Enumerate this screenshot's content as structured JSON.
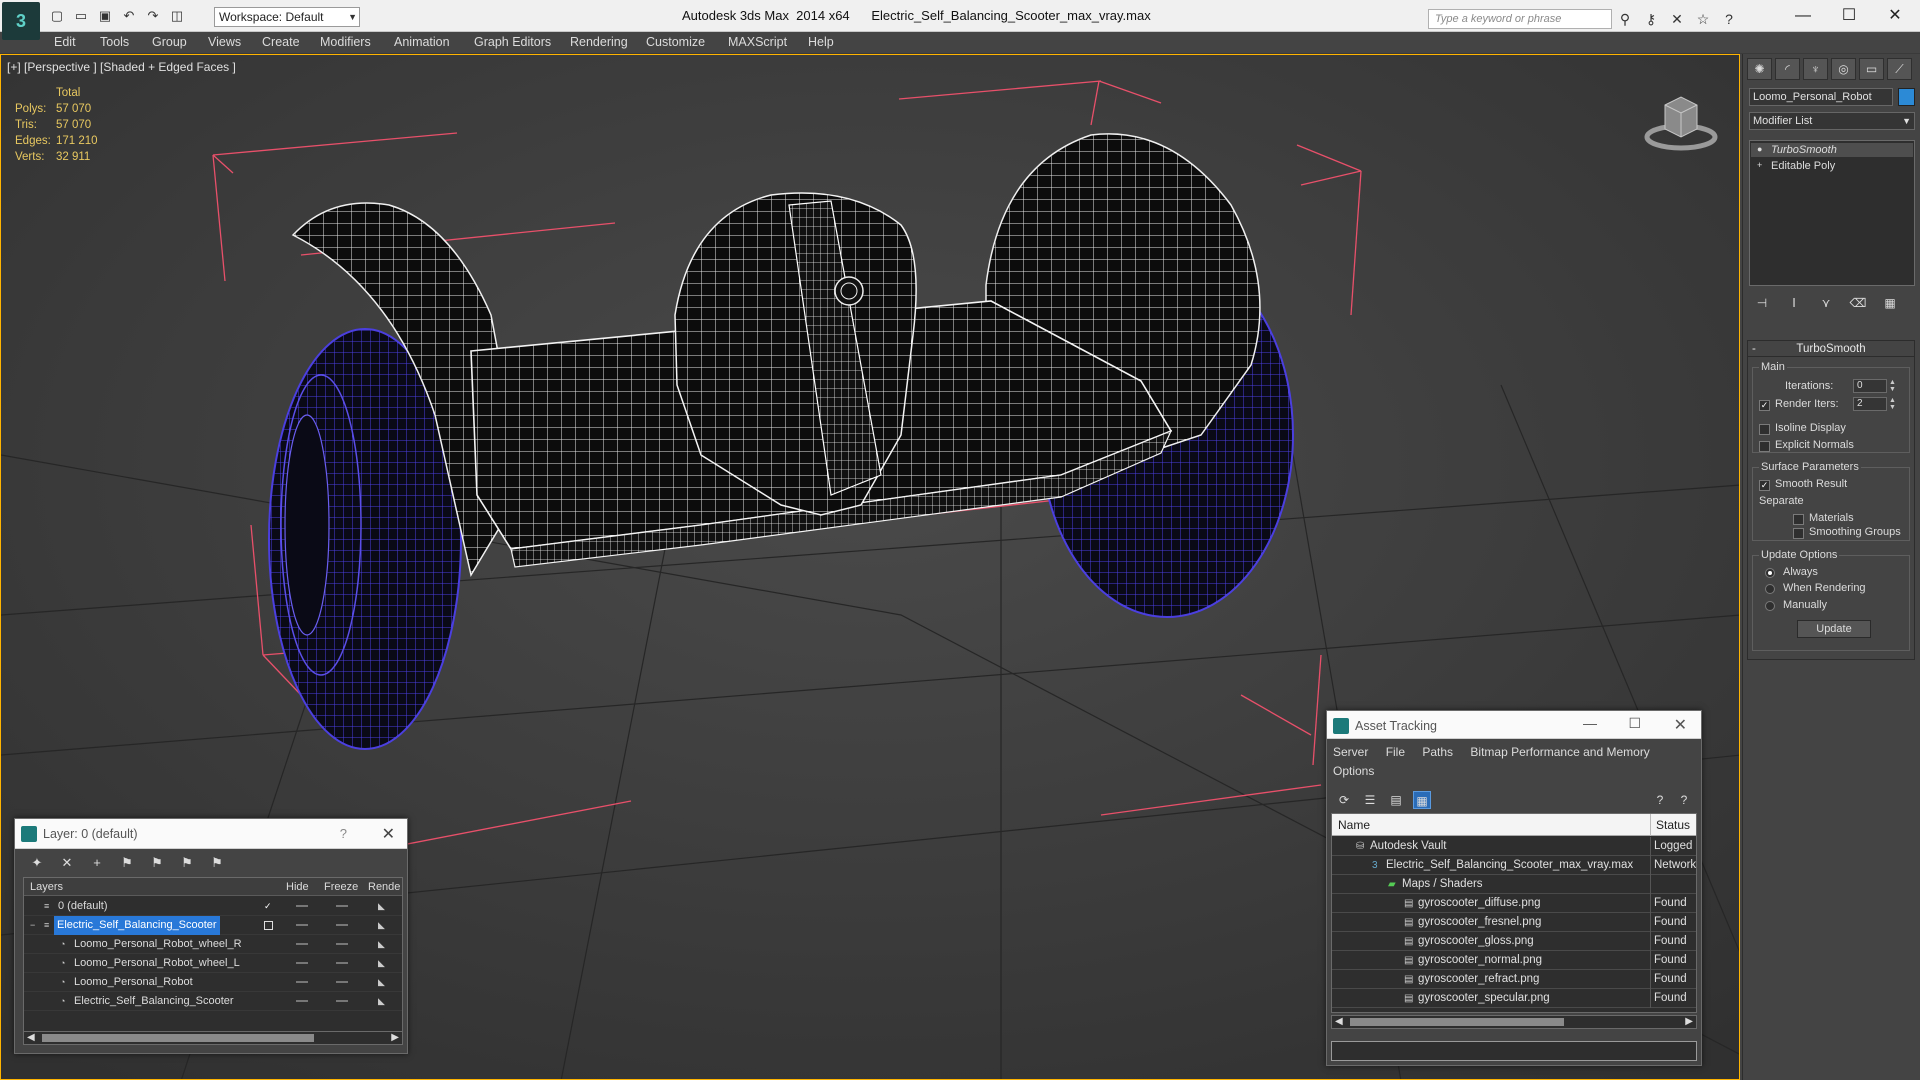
{
  "titlebar": {
    "title": "Autodesk 3ds Max  2014 x64      Electric_Self_Balancing_Scooter_max_vray.max",
    "workspace_label": "Workspace: Default",
    "search_placeholder": "Type a keyword or phrase",
    "minimize_label": "—",
    "maximize_label": "☐",
    "close_label": "✕"
  },
  "menu": [
    "Edit",
    "Tools",
    "Group",
    "Views",
    "Create",
    "Modifiers",
    "Animation",
    "Graph Editors",
    "Rendering",
    "Customize",
    "MAXScript",
    "Help"
  ],
  "viewport": {
    "label": "[+] [Perspective ] [Shaded + Edged Faces ]",
    "stats_header": "Total",
    "stats": [
      {
        "k": "Polys:",
        "v": "57 070"
      },
      {
        "k": "Tris:",
        "v": "57 070"
      },
      {
        "k": "Edges:",
        "v": "171 210"
      },
      {
        "k": "Verts:",
        "v": "32 911"
      }
    ],
    "colors": {
      "wire": "#ffffff",
      "wheel_wire": "#4a3fd8",
      "bbox": "#e8506a",
      "grid": "#232323",
      "stats": "#e8c860"
    }
  },
  "command_panel": {
    "object_name": "Loomo_Personal_Robot",
    "object_color": "#2c8ad6",
    "modifier_list_label": "Modifier List",
    "stack": [
      "TurboSmooth",
      "Editable Poly"
    ],
    "rollout_title": "TurboSmooth",
    "main_label": "Main",
    "iterations_label": "Iterations:",
    "iterations_value": "0",
    "render_iters_label": "Render Iters:",
    "render_iters_value": "2",
    "render_iters_checked": true,
    "isoline_label": "Isoline Display",
    "explicit_normals_label": "Explicit Normals",
    "surface_params_label": "Surface Parameters",
    "smooth_result_label": "Smooth Result",
    "separate_label": "Separate",
    "materials_label": "Materials",
    "smoothing_groups_label": "Smoothing Groups",
    "update_options_label": "Update Options",
    "update_always": "Always",
    "update_when_rendering": "When Rendering",
    "update_manually": "Manually",
    "update_button": "Update"
  },
  "layer_dialog": {
    "title": "Layer: 0 (default)",
    "help": "?",
    "close": "✕",
    "columns": {
      "layers": "Layers",
      "hide": "Hide",
      "freeze": "Freeze",
      "render": "Rende"
    },
    "rows": [
      {
        "name": "0 (default)",
        "indent": 0,
        "selected": false,
        "active": true
      },
      {
        "name": "Electric_Self_Balancing_Scooter",
        "indent": 0,
        "selected": true,
        "active": false
      },
      {
        "name": "Loomo_Personal_Robot_wheel_R",
        "indent": 1,
        "selected": false,
        "active": false
      },
      {
        "name": "Loomo_Personal_Robot_wheel_L",
        "indent": 1,
        "selected": false,
        "active": false
      },
      {
        "name": "Loomo_Personal_Robot",
        "indent": 1,
        "selected": false,
        "active": false
      },
      {
        "name": "Electric_Self_Balancing_Scooter",
        "indent": 1,
        "selected": false,
        "active": false
      }
    ]
  },
  "asset_tracking": {
    "title": "Asset Tracking",
    "menu_row1": [
      "Server",
      "File",
      "Paths",
      "Bitmap Performance and Memory"
    ],
    "menu_row2": [
      "Options"
    ],
    "col_name": "Name",
    "col_status": "Status",
    "rows": [
      {
        "name": "Autodesk Vault",
        "status": "Logged",
        "indent": 1,
        "icon": "vault-icon"
      },
      {
        "name": "Electric_Self_Balancing_Scooter_max_vray.max",
        "status": "Network",
        "indent": 2,
        "icon": "max-file-icon"
      },
      {
        "name": "Maps / Shaders",
        "status": "",
        "indent": 3,
        "icon": "maps-icon"
      },
      {
        "name": "gyroscooter_diffuse.png",
        "status": "Found",
        "indent": 4,
        "icon": "image-file-icon"
      },
      {
        "name": "gyroscooter_fresnel.png",
        "status": "Found",
        "indent": 4,
        "icon": "image-file-icon"
      },
      {
        "name": "gyroscooter_gloss.png",
        "status": "Found",
        "indent": 4,
        "icon": "image-file-icon"
      },
      {
        "name": "gyroscooter_normal.png",
        "status": "Found",
        "indent": 4,
        "icon": "image-file-icon"
      },
      {
        "name": "gyroscooter_refract.png",
        "status": "Found",
        "indent": 4,
        "icon": "image-file-icon"
      },
      {
        "name": "gyroscooter_specular.png",
        "status": "Found",
        "indent": 4,
        "icon": "image-file-icon"
      }
    ]
  }
}
